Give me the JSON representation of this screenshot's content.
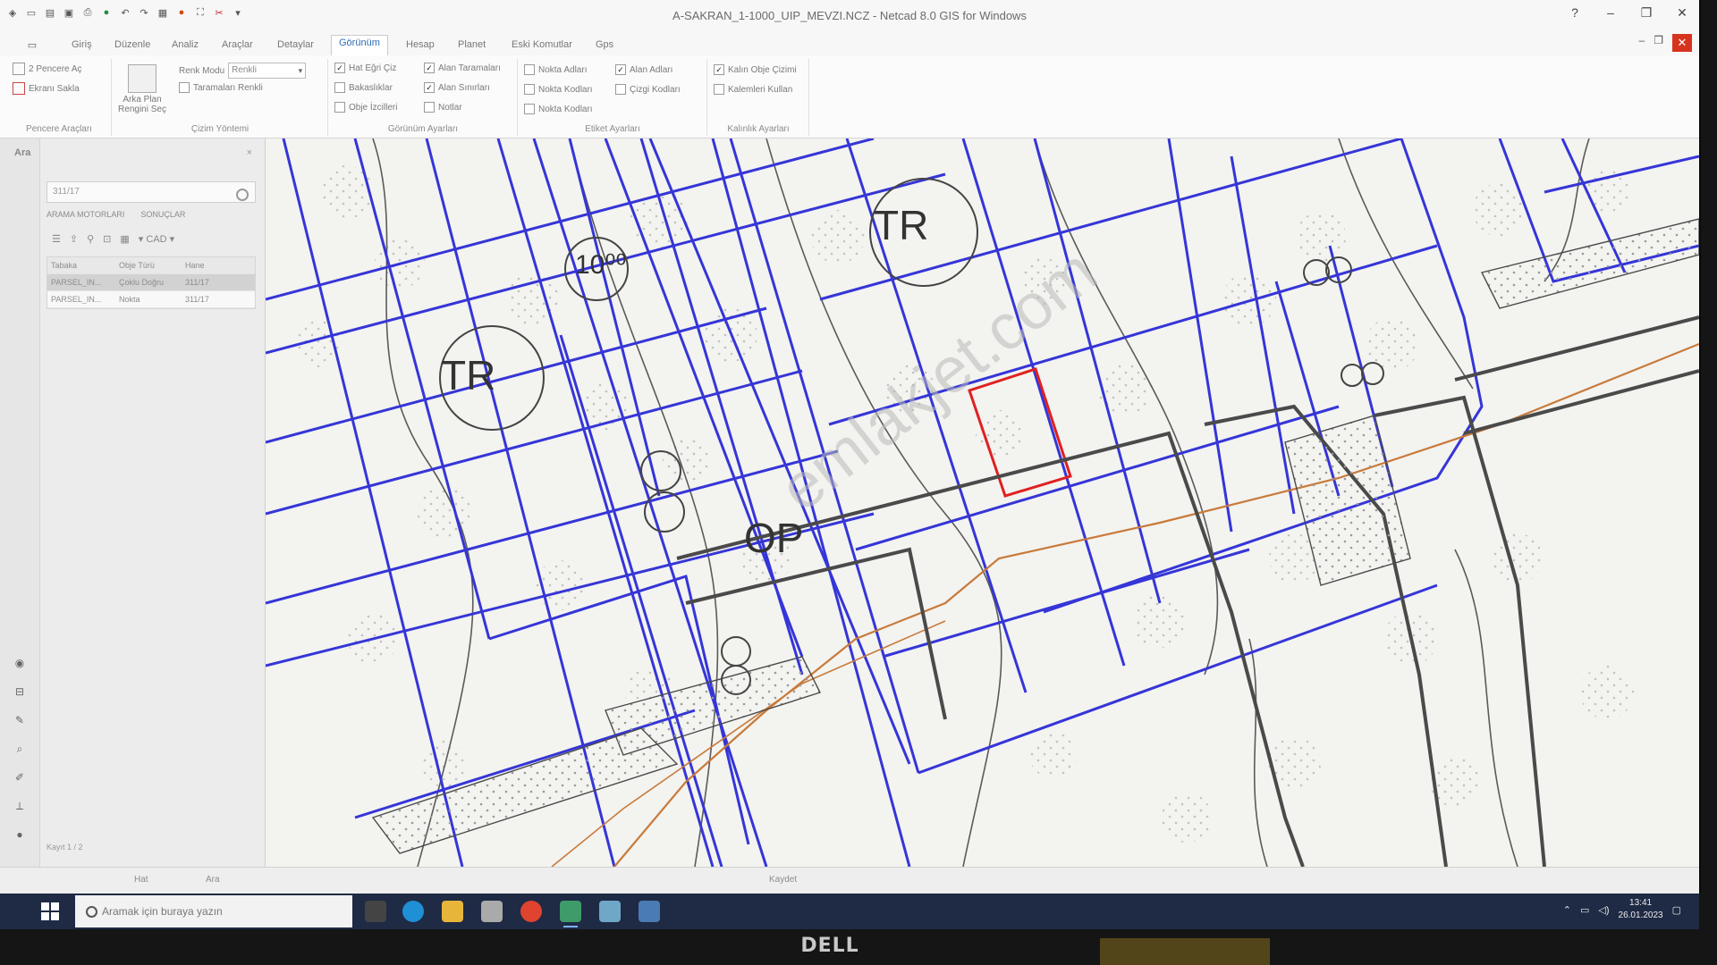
{
  "window": {
    "title": "A-SAKRAN_1-1000_UIP_MEVZI.NCZ - Netcad 8.0 GIS for Windows",
    "controls": [
      "?",
      "–",
      "❐",
      "✕"
    ],
    "doc_controls": [
      "–",
      "❐",
      "✕"
    ]
  },
  "tabs": [
    {
      "label": "Giriş",
      "active": false
    },
    {
      "label": "Düzenle",
      "active": false
    },
    {
      "label": "Analiz",
      "active": false
    },
    {
      "label": "Araçlar",
      "active": false
    },
    {
      "label": "Detaylar",
      "active": false
    },
    {
      "label": "Görünüm",
      "active": true
    },
    {
      "label": "Hesap",
      "active": false
    },
    {
      "label": "Planet",
      "active": false
    },
    {
      "label": "Eski Komutlar",
      "active": false
    },
    {
      "label": "Gps",
      "active": false
    }
  ],
  "ribbon": {
    "pencere": {
      "label": "Pencere Araçları",
      "items": [
        "2 Pencere Aç",
        "Ekranı Sakla"
      ]
    },
    "cizim": {
      "label": "Çizim Yöntemi",
      "big_button": "Arka Plan Rengini Seç",
      "mode_label": "Renk Modu",
      "mode_value": "Renkli",
      "tarama": "Taramaları Renkli"
    },
    "gorunum": {
      "label": "Görünüm Ayarları",
      "items": [
        {
          "label": "Hat Eğri Çiz",
          "checked": true
        },
        {
          "label": "Alan Taramaları",
          "checked": true
        },
        {
          "label": "Bakaslıklar",
          "checked": false
        },
        {
          "label": "Alan Sınırları",
          "checked": true
        },
        {
          "label": "Obje İzcilleri",
          "checked": false
        },
        {
          "label": "Notlar",
          "checked": false
        }
      ]
    },
    "etiket": {
      "label": "Etiket Ayarları",
      "items": [
        {
          "label": "Nokta Adları",
          "checked": false
        },
        {
          "label": "Alan Adları",
          "checked": true
        },
        {
          "label": "Nokta Kodları",
          "checked": false
        },
        {
          "label": "Çizgi Kodları",
          "checked": false
        },
        {
          "label": "Nokta Kodları",
          "checked": false
        }
      ]
    },
    "kalinlik": {
      "label": "Kalınlık Ayarları",
      "items": [
        {
          "label": "Kalın Obje Çizimi",
          "checked": true
        },
        {
          "label": "Kalemleri Kullan",
          "checked": false
        }
      ]
    }
  },
  "left_panel": {
    "title": "Ara",
    "search_value": "311/17",
    "sub_tabs": [
      "ARAMA MOTORLARI",
      "SONUÇLAR"
    ],
    "toolbar_label": "CAD",
    "columns": [
      "Tabaka",
      "Obje Türü",
      "Hane"
    ],
    "rows": [
      [
        "PARSEL_IN...",
        "Çoklu Doğru",
        "311/17"
      ],
      [
        "PARSEL_IN...",
        "Nokta",
        "311/17"
      ]
    ],
    "status": "Kayıt 1 / 2"
  },
  "map": {
    "labels": [
      {
        "text": "TR"
      },
      {
        "text": "TR"
      },
      {
        "text": "10⁰⁰"
      },
      {
        "text": "OP"
      }
    ],
    "watermark": "emlakjet.com",
    "colors": {
      "parcel": "#3535d8",
      "selected": "#e02020",
      "road": "#4a4a4a",
      "pipeline": "#c87a3a",
      "contour": "#555555"
    }
  },
  "statusbar": {
    "items": [
      "Hat",
      "Ara",
      "Kaydet"
    ]
  },
  "taskbar": {
    "search_placeholder": "Aramak için buraya yazın",
    "time": "13:41",
    "date": "26.01.2023"
  },
  "monitor": {
    "brand": "DELL"
  }
}
